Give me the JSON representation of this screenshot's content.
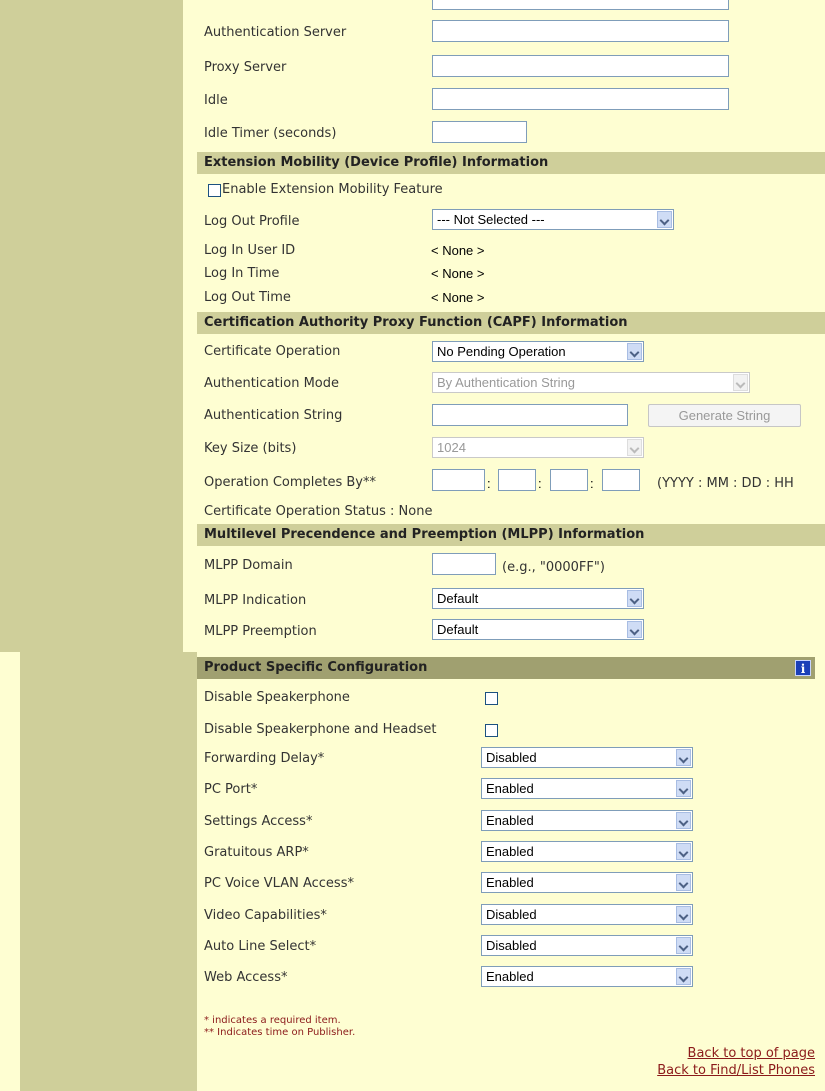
{
  "top_fields": [
    {
      "label": "Authentication Server"
    },
    {
      "label": "Proxy Server"
    },
    {
      "label": "Idle"
    },
    {
      "label": "Idle Timer (seconds)"
    }
  ],
  "extension_mobility": {
    "title": "Extension Mobility (Device Profile) Information",
    "enable_label": "Enable Extension Mobility Feature",
    "log_out_profile_label": "Log Out Profile",
    "log_out_profile_value": "--- Not Selected ---",
    "rows": [
      {
        "label": "Log In User ID",
        "value": "< None >"
      },
      {
        "label": "Log In Time",
        "value": "< None >"
      },
      {
        "label": "Log Out Time",
        "value": "< None >"
      }
    ]
  },
  "capf": {
    "title": "Certification Authority Proxy Function (CAPF) Information",
    "cert_op_label": "Certificate Operation",
    "cert_op_value": "No Pending Operation",
    "auth_mode_label": "Authentication Mode",
    "auth_mode_value": "By Authentication String",
    "auth_string_label": "Authentication String",
    "generate_button": "Generate String",
    "key_size_label": "Key Size (bits)",
    "key_size_value": "1024",
    "op_completes_label": "Operation Completes By**",
    "sep": ":",
    "date_format": "(YYYY : MM : DD : HH",
    "status_label": "Certificate Operation Status : None"
  },
  "mlpp": {
    "title": "Multilevel Precendence and Preemption (MLPP) Information",
    "domain_label": "MLPP Domain",
    "domain_hint": "(e.g., \"0000FF\")",
    "indication_label": "MLPP Indication",
    "indication_value": "Default",
    "preemption_label": "MLPP Preemption",
    "preemption_value": "Default"
  },
  "product_config": {
    "title": "Product Specific Configuration",
    "info_icon": "i",
    "checkboxes": [
      {
        "label": "Disable Speakerphone",
        "checked": false
      },
      {
        "label": "Disable Speakerphone and Headset",
        "checked": false
      }
    ],
    "selects": [
      {
        "label": "Forwarding Delay*",
        "value": "Disabled"
      },
      {
        "label": "PC Port*",
        "value": "Enabled"
      },
      {
        "label": "Settings Access*",
        "value": "Enabled"
      },
      {
        "label": "Gratuitous ARP*",
        "value": "Enabled"
      },
      {
        "label": "PC Voice VLAN Access*",
        "value": "Enabled"
      },
      {
        "label": "Video Capabilities*",
        "value": "Disabled"
      },
      {
        "label": "Auto Line Select*",
        "value": "Disabled"
      },
      {
        "label": "Web Access*",
        "value": "Enabled"
      }
    ]
  },
  "footer": {
    "note1": "* indicates a required item.",
    "note2": "** Indicates time on Publisher.",
    "link1": "Back to top of page",
    "link2": "Back to Find/List Phones"
  },
  "colors": {
    "background": "#fefed2",
    "sidebar": "#cfcf9a",
    "section_header": "#cfcf9a",
    "product_header": "#a0a070",
    "link": "#8b1a1a"
  }
}
